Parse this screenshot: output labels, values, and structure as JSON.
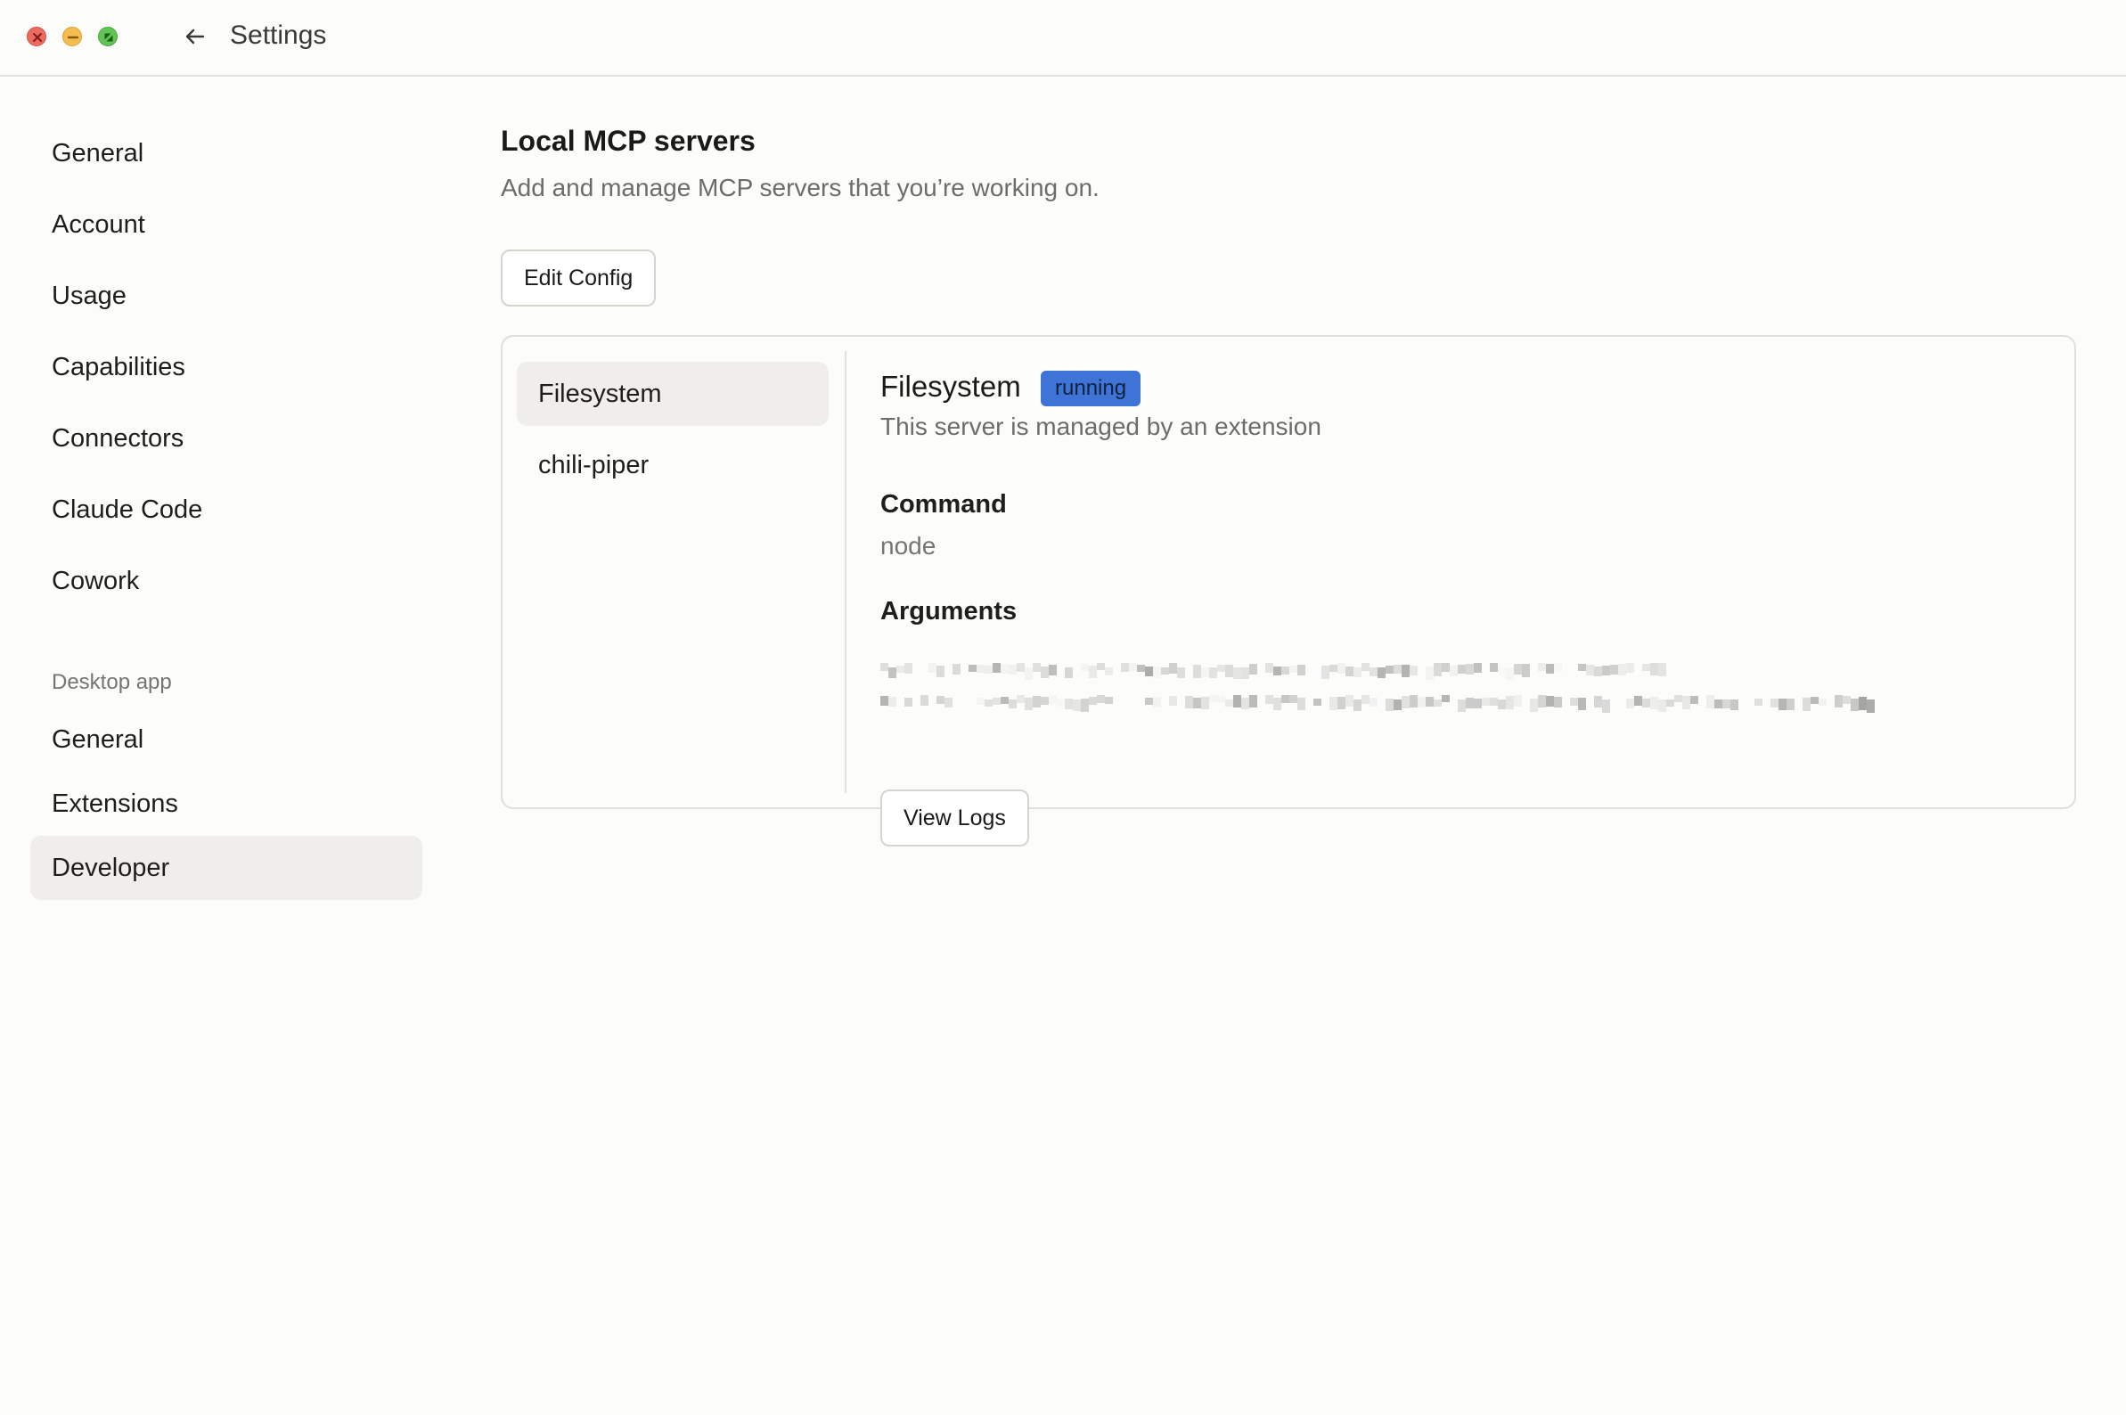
{
  "window": {
    "title": "Settings"
  },
  "sidebar": {
    "items": [
      {
        "label": "General"
      },
      {
        "label": "Account"
      },
      {
        "label": "Usage"
      },
      {
        "label": "Capabilities"
      },
      {
        "label": "Connectors"
      },
      {
        "label": "Claude Code"
      },
      {
        "label": "Cowork"
      }
    ],
    "desktop_section_label": "Desktop app",
    "desktop_items": [
      {
        "label": "General"
      },
      {
        "label": "Extensions"
      },
      {
        "label": "Developer",
        "active": true
      }
    ]
  },
  "main": {
    "title": "Local MCP servers",
    "subtitle": "Add and manage MCP servers that you’re working on.",
    "edit_config_label": "Edit Config",
    "servers": [
      {
        "name": "Filesystem",
        "active": true
      },
      {
        "name": "chili-piper"
      }
    ],
    "detail": {
      "name": "Filesystem",
      "status": "running",
      "description": "This server is managed by an extension",
      "command_label": "Command",
      "command_value": "node",
      "arguments_label": "Arguments",
      "view_logs_label": "View Logs"
    }
  },
  "colors": {
    "background": "#fcfcfb",
    "active_item": "#efeeeb",
    "status_running": "#3d74d6",
    "border": "#e0dfdb"
  },
  "icons": {
    "back": "arrow-left-icon",
    "close": "close-icon",
    "minimize": "minimize-icon",
    "maximize": "maximize-icon"
  }
}
